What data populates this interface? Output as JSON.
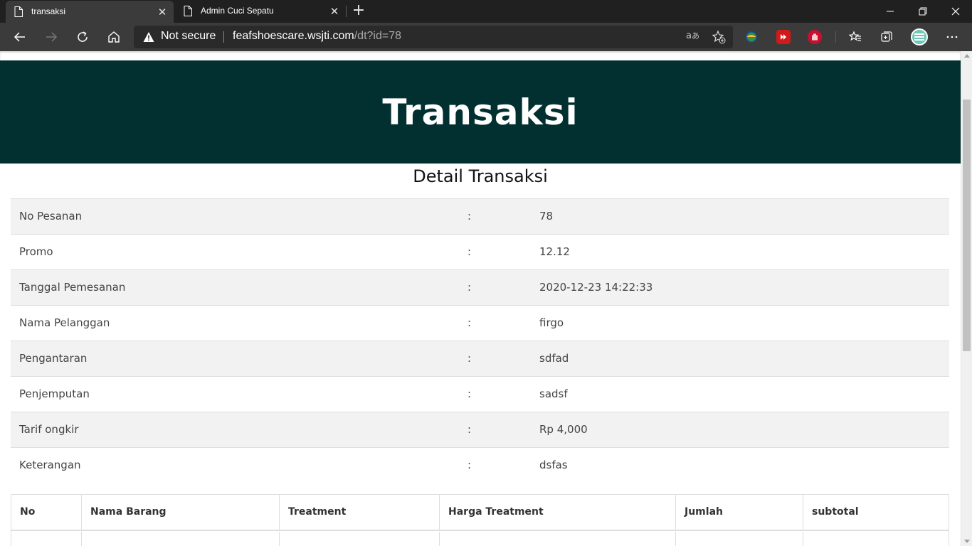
{
  "browser": {
    "tabs": [
      {
        "title": "transaksi",
        "active": true
      },
      {
        "title": "Admin Cuci Sepatu",
        "active": false
      }
    ],
    "address": {
      "security_label": "Not secure",
      "host": "feafshoescare.wsjti.com",
      "path": "/dt?id=78"
    },
    "colors": {
      "tabstrip": "#202020",
      "toolbar": "#3b3b3b"
    }
  },
  "page": {
    "hero_title": "Transaksi",
    "subtitle": "Detail Transaksi",
    "hero_color": "#023030",
    "detail_rows": [
      {
        "label": "No Pesanan",
        "sep": ":",
        "value": "78"
      },
      {
        "label": "Promo",
        "sep": ":",
        "value": "12.12"
      },
      {
        "label": "Tanggal Pemesanan",
        "sep": ":",
        "value": "2020-12-23 14:22:33"
      },
      {
        "label": "Nama Pelanggan",
        "sep": ":",
        "value": "firgo"
      },
      {
        "label": "Pengantaran",
        "sep": ":",
        "value": "sdfad"
      },
      {
        "label": "Penjemputan",
        "sep": ":",
        "value": "sadsf"
      },
      {
        "label": "Tarif ongkir",
        "sep": ":",
        "value": "Rp 4,000"
      },
      {
        "label": "Keterangan",
        "sep": ":",
        "value": "dsfas"
      }
    ],
    "items_table": {
      "headers": [
        "No",
        "Nama Barang",
        "Treatment",
        "Harga Treatment",
        "Jumlah",
        "subtotal"
      ]
    }
  }
}
